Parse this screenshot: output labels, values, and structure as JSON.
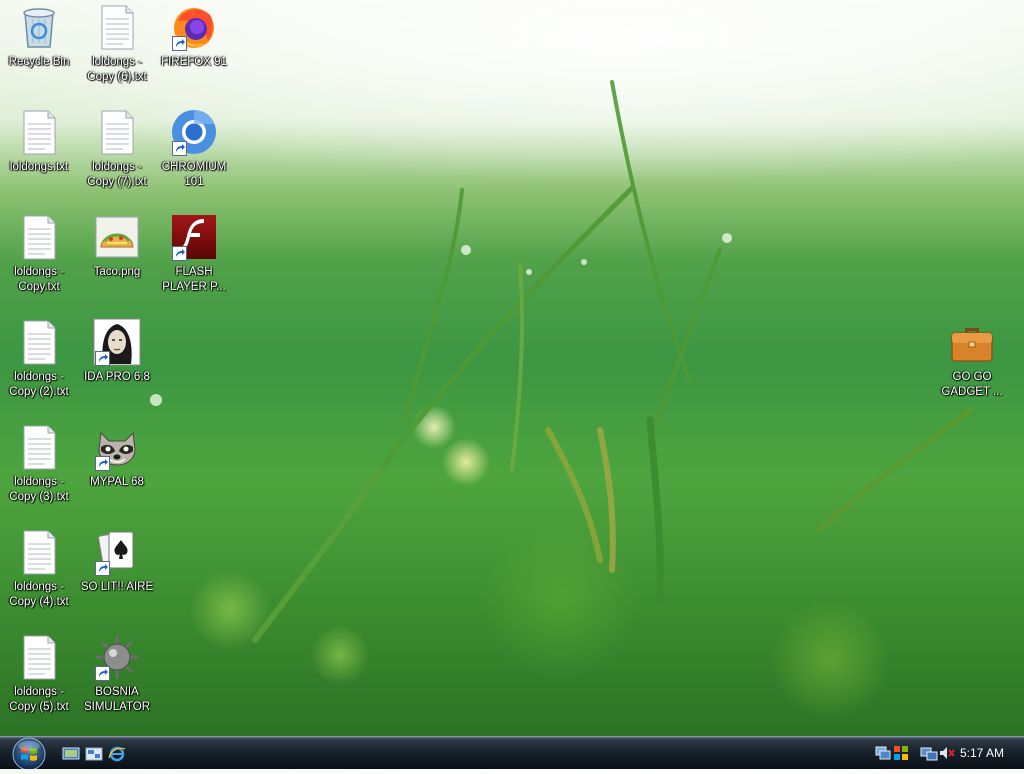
{
  "desktop": {
    "icons": [
      {
        "id": "recycle-bin",
        "label": "Recycle Bin",
        "icon": "recycle-bin-icon",
        "shortcut": false
      },
      {
        "id": "loldongs-copy-6",
        "label": "loldongs -\nCopy (6).txt",
        "icon": "text-file-icon",
        "shortcut": false
      },
      {
        "id": "firefox-91",
        "label": "FIREFOX 91",
        "icon": "firefox-icon",
        "shortcut": true
      },
      {
        "id": "loldongs",
        "label": "loldongs.txt",
        "icon": "text-file-icon",
        "shortcut": false
      },
      {
        "id": "loldongs-copy-7",
        "label": "loldongs -\nCopy (7).txt",
        "icon": "text-file-icon",
        "shortcut": false
      },
      {
        "id": "chromium-101",
        "label": "CHROMIUM\n101",
        "icon": "chromium-icon",
        "shortcut": true
      },
      {
        "id": "loldongs-copy",
        "label": "loldongs -\nCopy.txt",
        "icon": "text-file-icon",
        "shortcut": false
      },
      {
        "id": "taco-png",
        "label": "Taco.png",
        "icon": "taco-image-icon",
        "shortcut": false
      },
      {
        "id": "flash-player",
        "label": "FLASH\nPLAYER P...",
        "icon": "flash-player-icon",
        "shortcut": true
      },
      {
        "id": "loldongs-copy-2",
        "label": "loldongs -\nCopy (2).txt",
        "icon": "text-file-icon",
        "shortcut": false
      },
      {
        "id": "ida-pro",
        "label": "IDA PRO 6.8",
        "icon": "ida-pro-icon",
        "shortcut": true
      },
      {
        "id": "go-go-gadget",
        "label": "GO GO\nGADGET ...",
        "icon": "briefcase-icon",
        "shortcut": false
      },
      {
        "id": "loldongs-copy-3",
        "label": "loldongs -\nCopy (3).txt",
        "icon": "text-file-icon",
        "shortcut": false
      },
      {
        "id": "mypal-68",
        "label": "MYPAL 68",
        "icon": "mypal-raccoon-icon",
        "shortcut": true
      },
      {
        "id": "loldongs-copy-4",
        "label": "loldongs -\nCopy (4).txt",
        "icon": "text-file-icon",
        "shortcut": false
      },
      {
        "id": "solitaire",
        "label": "SO LIT!! AIRE",
        "icon": "solitaire-cards-icon",
        "shortcut": true
      },
      {
        "id": "loldongs-copy-5",
        "label": "loldongs -\nCopy (5).txt",
        "icon": "text-file-icon",
        "shortcut": false
      },
      {
        "id": "bosnia-simulator",
        "label": "BOSNIA\nSIMULATOR",
        "icon": "naval-mine-icon",
        "shortcut": true
      }
    ]
  },
  "taskbar": {
    "start_icon": "windows-orb-icon",
    "quick_launch": [
      {
        "id": "show-desktop",
        "icon": "show-desktop-icon"
      },
      {
        "id": "switch-windows",
        "icon": "switch-windows-icon"
      },
      {
        "id": "internet-explorer",
        "icon": "internet-explorer-icon"
      }
    ],
    "tray": {
      "icons": [
        "computer-network-icon",
        "windows-security-icon",
        "network-icon",
        "volume-muted-icon"
      ],
      "clock": "5:17 AM"
    }
  },
  "colors": {
    "taskbar_bg": "#16202b",
    "label_text": "#ffffff",
    "wallpaper_green": "#3c9642"
  }
}
